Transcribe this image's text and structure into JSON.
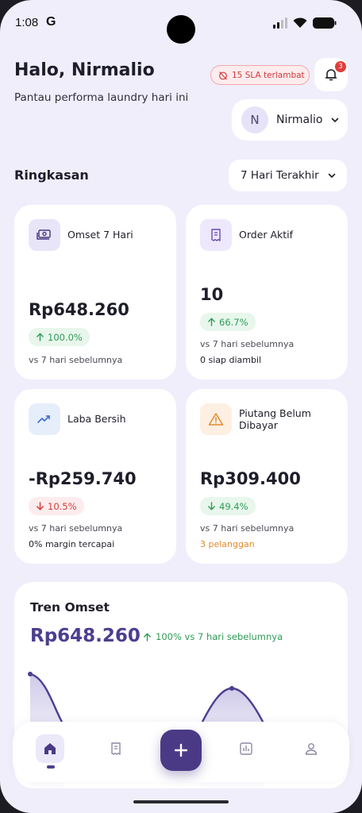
{
  "status_bar": {
    "time": "1:08",
    "app_glyph": "G"
  },
  "header": {
    "greeting": "Halo, Nirmalio",
    "subtitle": "Pantau performa laundry hari ini",
    "sla_badge": "15 SLA terlambat",
    "notification_count": "3",
    "user_initial": "N",
    "user_name": "Nirmalio"
  },
  "summary": {
    "title": "Ringkasan",
    "period": "7 Hari Terakhir",
    "cards": [
      {
        "label": "Omset 7 Hari",
        "value": "Rp648.260",
        "delta": "100.0%",
        "delta_dir": "up",
        "vs": "vs 7 hari sebelumnya",
        "foot": "",
        "icon": "cash-icon"
      },
      {
        "label": "Order Aktif",
        "value": "10",
        "delta": "66.7%",
        "delta_dir": "up",
        "vs": "vs 7 hari sebelumnya",
        "foot": "0 siap diambil",
        "icon": "receipt-icon"
      },
      {
        "label": "Laba Bersih",
        "value": "-Rp259.740",
        "delta": "10.5%",
        "delta_dir": "down",
        "vs": "vs 7 hari sebelumnya",
        "foot": "0% margin tercapai",
        "icon": "trending-icon"
      },
      {
        "label": "Piutang Belum Dibayar",
        "value": "Rp309.400",
        "delta": "49.4%",
        "delta_dir": "down",
        "vs": "vs 7 hari sebelumnya",
        "foot": "3 pelanggan",
        "icon": "warning-icon"
      }
    ]
  },
  "trend": {
    "title": "Tren Omset",
    "value": "Rp648.260",
    "delta": "100% vs 7 hari sebelumnya"
  },
  "nav": {
    "items": [
      "home-icon",
      "receipt-icon",
      "add-icon",
      "chart-icon",
      "profile-icon"
    ],
    "active": "home"
  },
  "colors": {
    "background": "#f0eefb",
    "accent": "#4a3a86",
    "positive": "#2f9b57",
    "negative": "#d23a3a",
    "warning": "#e08a2a"
  }
}
